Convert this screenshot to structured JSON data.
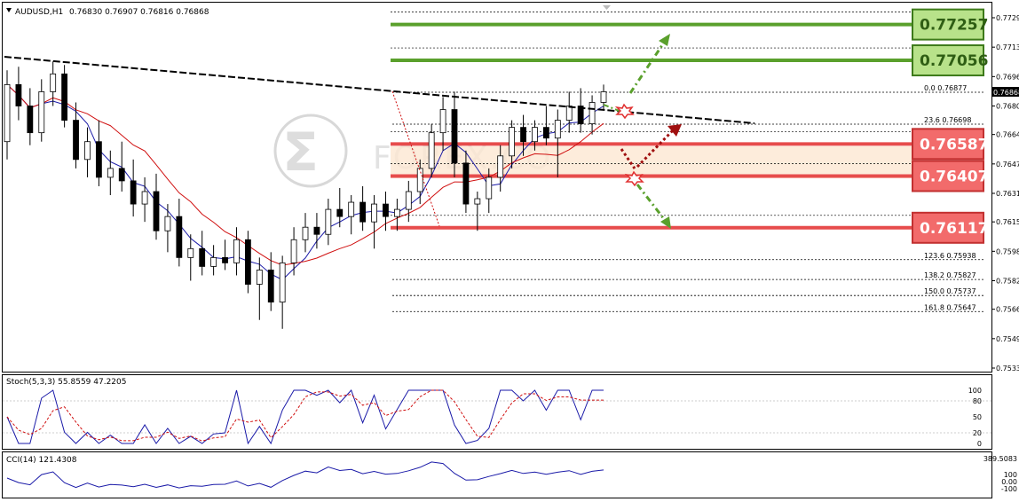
{
  "header": {
    "symbol": "AUDUSD,H1",
    "ohlc": "0.76830 0.76907 0.76816 0.76868"
  },
  "watermark": {
    "text": "FOREX.CO"
  },
  "colors": {
    "bull_body": "#ffffff",
    "bear_body": "#000000",
    "ma_fast": "#1a1aa8",
    "ma_slow": "#d01010",
    "resistance_green": "#5aa02c",
    "support_red": "#e74c4c",
    "tag_green_bg": "#b8e28a",
    "tag_red_bg": "#f26b6b",
    "stoch_main": "#1a1aa8",
    "stoch_signal": "#d01010",
    "cci": "#1a1aa8"
  },
  "price_axis": {
    "ticks": [
      "0.77295",
      "0.77130",
      "0.76965",
      "0.76800",
      "0.76640",
      "0.76475",
      "0.76310",
      "0.76150",
      "0.75985",
      "0.75820",
      "0.75660",
      "0.75495",
      "0.75330"
    ],
    "current_price": "0.76868"
  },
  "levels": {
    "resistance": [
      {
        "label": "0.77257",
        "price": 0.77257
      },
      {
        "label": "0.77056",
        "price": 0.77056
      }
    ],
    "support": [
      {
        "label": "0.76587",
        "price": 0.76587
      },
      {
        "label": "0.76407",
        "price": 0.76407
      },
      {
        "label": "0.76117",
        "price": 0.76117
      }
    ]
  },
  "fib_levels": [
    {
      "label": "0.0",
      "value": "0.76877",
      "price": 0.76877
    },
    {
      "label": "23.6",
      "value": "0.76698",
      "price": 0.76698
    },
    {
      "label": "123.6",
      "value": "0.75938",
      "price": 0.75938
    },
    {
      "label": "138.2",
      "value": "0.75827",
      "price": 0.75827
    },
    {
      "label": "150.0",
      "value": "0.75737",
      "price": 0.75737
    },
    {
      "label": "161.8",
      "value": "0.75647",
      "price": 0.75647
    }
  ],
  "stochastic": {
    "label": "Stoch(5,3,3) 55.8559 47.2205",
    "ticks": [
      "100",
      "80",
      "50",
      "20",
      "0"
    ]
  },
  "cci": {
    "label": "CCI(14) 121.4308",
    "ticks": [
      "389.5083",
      "100",
      "0.00",
      "-100"
    ]
  },
  "chart_data": {
    "type": "candlestick",
    "title": "AUDUSD,H1",
    "ylim": [
      0.7533,
      0.7733
    ],
    "trendline": {
      "start": 0.771,
      "end": 0.767
    },
    "candles_ohlc": [
      [
        0.766,
        0.77,
        0.765,
        0.7692
      ],
      [
        0.7692,
        0.7702,
        0.7672,
        0.768
      ],
      [
        0.768,
        0.769,
        0.7658,
        0.7665
      ],
      [
        0.7665,
        0.7695,
        0.766,
        0.7688
      ],
      [
        0.7688,
        0.7705,
        0.768,
        0.7698
      ],
      [
        0.7698,
        0.7703,
        0.7668,
        0.7672
      ],
      [
        0.7672,
        0.7682,
        0.7645,
        0.765
      ],
      [
        0.765,
        0.7668,
        0.764,
        0.766
      ],
      [
        0.766,
        0.7672,
        0.7635,
        0.764
      ],
      [
        0.764,
        0.7655,
        0.763,
        0.7645
      ],
      [
        0.7645,
        0.766,
        0.7632,
        0.7638
      ],
      [
        0.7638,
        0.765,
        0.7618,
        0.7625
      ],
      [
        0.7625,
        0.764,
        0.7615,
        0.7632
      ],
      [
        0.7632,
        0.7642,
        0.7605,
        0.761
      ],
      [
        0.761,
        0.7625,
        0.7598,
        0.7618
      ],
      [
        0.7618,
        0.7628,
        0.759,
        0.7595
      ],
      [
        0.7595,
        0.7608,
        0.7582,
        0.76
      ],
      [
        0.76,
        0.761,
        0.7585,
        0.759
      ],
      [
        0.759,
        0.7602,
        0.7585,
        0.7595
      ],
      [
        0.7595,
        0.7605,
        0.7588,
        0.7592
      ],
      [
        0.7592,
        0.7612,
        0.7585,
        0.7605
      ],
      [
        0.7605,
        0.761,
        0.7575,
        0.758
      ],
      [
        0.758,
        0.7595,
        0.756,
        0.7588
      ],
      [
        0.7588,
        0.7598,
        0.7565,
        0.757
      ],
      [
        0.757,
        0.7596,
        0.7555,
        0.7592
      ],
      [
        0.7592,
        0.7612,
        0.7585,
        0.7605
      ],
      [
        0.7605,
        0.762,
        0.7598,
        0.7612
      ],
      [
        0.7612,
        0.762,
        0.76,
        0.7608
      ],
      [
        0.7608,
        0.7628,
        0.7602,
        0.7622
      ],
      [
        0.7622,
        0.7634,
        0.7612,
        0.7618
      ],
      [
        0.7618,
        0.763,
        0.7608,
        0.7626
      ],
      [
        0.7626,
        0.7635,
        0.761,
        0.7615
      ],
      [
        0.7615,
        0.763,
        0.76,
        0.7625
      ],
      [
        0.7625,
        0.7632,
        0.761,
        0.7618
      ],
      [
        0.7618,
        0.7628,
        0.761,
        0.7622
      ],
      [
        0.7622,
        0.7638,
        0.7615,
        0.7632
      ],
      [
        0.7632,
        0.765,
        0.7625,
        0.7645
      ],
      [
        0.7645,
        0.767,
        0.764,
        0.7665
      ],
      [
        0.7665,
        0.7685,
        0.7655,
        0.7678
      ],
      [
        0.7678,
        0.7688,
        0.764,
        0.7648
      ],
      [
        0.7648,
        0.7655,
        0.762,
        0.7625
      ],
      [
        0.7625,
        0.7632,
        0.761,
        0.7628
      ],
      [
        0.7628,
        0.7645,
        0.762,
        0.764
      ],
      [
        0.764,
        0.7658,
        0.7632,
        0.7652
      ],
      [
        0.7652,
        0.7672,
        0.7645,
        0.7668
      ],
      [
        0.7668,
        0.7675,
        0.7652,
        0.766
      ],
      [
        0.766,
        0.7672,
        0.7655,
        0.7668
      ],
      [
        0.7668,
        0.768,
        0.7658,
        0.7662
      ],
      [
        0.7662,
        0.7678,
        0.764,
        0.7672
      ],
      [
        0.7672,
        0.7688,
        0.7665,
        0.768
      ],
      [
        0.768,
        0.769,
        0.7665,
        0.767
      ],
      [
        0.767,
        0.7686,
        0.7664,
        0.7682
      ],
      [
        0.7682,
        0.7692,
        0.7678,
        0.7688
      ]
    ]
  }
}
